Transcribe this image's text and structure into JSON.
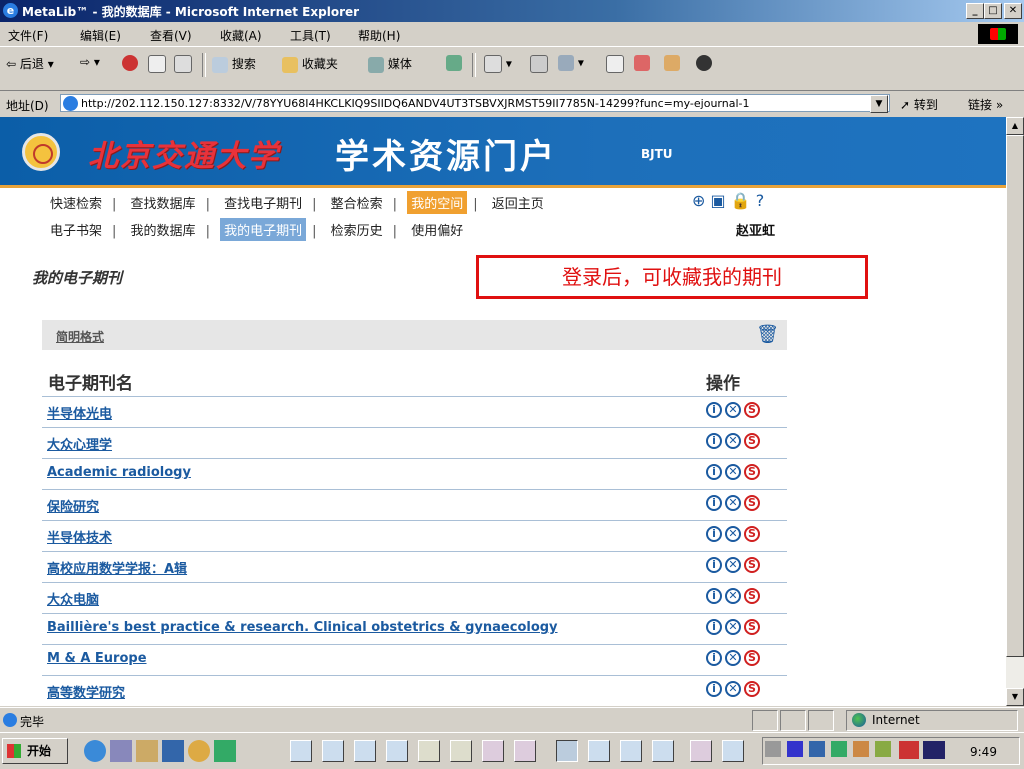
{
  "window": {
    "title": "MetaLib™ - 我的数据库 - Microsoft Internet Explorer"
  },
  "menu": [
    "文件(F)",
    "编辑(E)",
    "查看(V)",
    "收藏(A)",
    "工具(T)",
    "帮助(H)"
  ],
  "toolbar": {
    "back": "后退",
    "search": "搜索",
    "favorites": "收藏夹",
    "media": "媒体"
  },
  "address": {
    "label": "地址(D)",
    "url": "http://202.112.150.127:8332/V/78YYU68I4HKCLKIQ9SIIDQ6ANDV4UT3TSBVXJRMST59II7785N-14299?func=my-ejournal-1",
    "go": "转到",
    "links": "链接"
  },
  "banner": {
    "university": "北京交通大学",
    "portal": "学术资源门户",
    "code": "BJTU"
  },
  "nav_row1": [
    {
      "label": "快速检索"
    },
    {
      "label": "查找数据库"
    },
    {
      "label": "查找电子期刊"
    },
    {
      "label": "整合检索"
    },
    {
      "label": "我的空间"
    },
    {
      "label": "返回主页"
    }
  ],
  "nav_row2": [
    {
      "label": "电子书架"
    },
    {
      "label": "我的数据库"
    },
    {
      "label": "我的电子期刊"
    },
    {
      "label": "检索历史"
    },
    {
      "label": "使用偏好"
    }
  ],
  "user": {
    "name": "赵亚虹"
  },
  "page": {
    "title": "我的电子期刊",
    "callout": "登录后，可收藏我的期刊",
    "format_label": "简明格式",
    "col_name": "电子期刊名",
    "col_ops": "操作"
  },
  "journals": [
    "半导体光电",
    "大众心理学",
    "Academic radiology",
    "保险研究",
    "半导体技术",
    "高校应用数学学报：A辑",
    "大众电脑",
    "Baillière's best practice & research. Clinical obstetrics & gynaecology",
    "M & A Europe",
    "高等数学研究"
  ],
  "status": {
    "text": "完毕",
    "zone": "Internet"
  },
  "taskbar": {
    "start": "开始",
    "clock": "9:49"
  }
}
